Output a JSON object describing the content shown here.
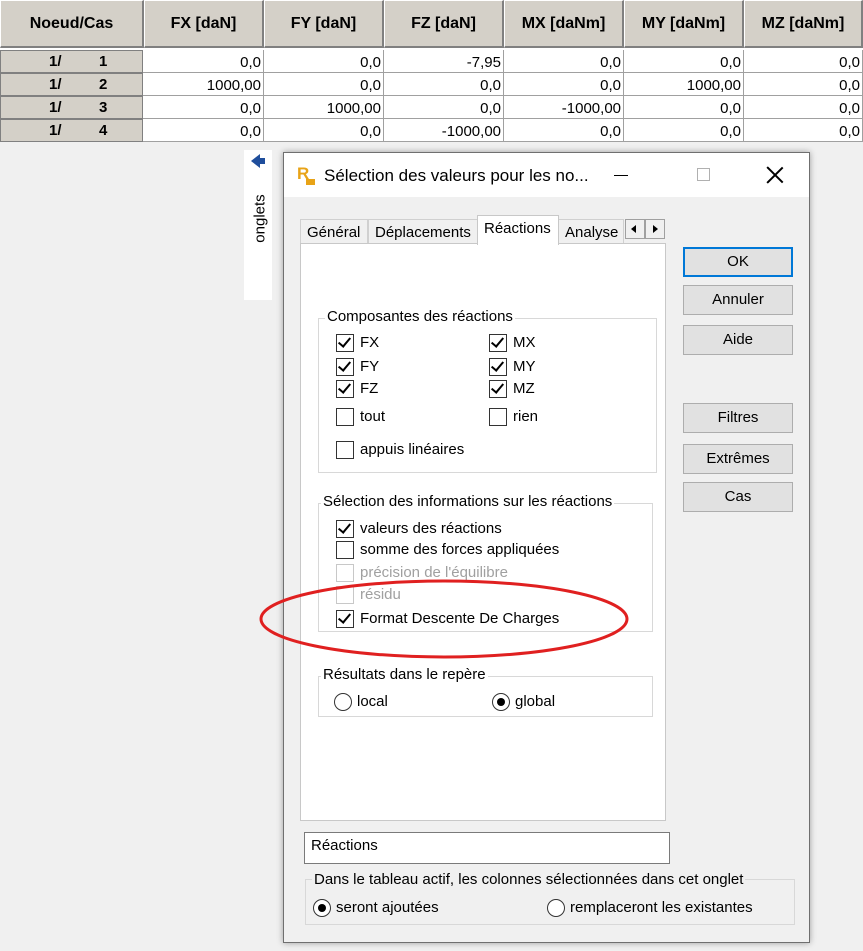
{
  "table": {
    "headers": [
      "Noeud/Cas",
      "FX [daN]",
      "FY [daN]",
      "FZ [daN]",
      "MX [daNm]",
      "MY [daNm]",
      "MZ [daNm]"
    ],
    "rows": [
      {
        "node": "1/",
        "case": "1",
        "values": [
          "0,0",
          "0,0",
          "-7,95",
          "0,0",
          "0,0",
          "0,0"
        ]
      },
      {
        "node": "1/",
        "case": "2",
        "values": [
          "1000,00",
          "0,0",
          "0,0",
          "0,0",
          "1000,00",
          "0,0"
        ]
      },
      {
        "node": "1/",
        "case": "3",
        "values": [
          "0,0",
          "1000,00",
          "0,0",
          "-1000,00",
          "0,0",
          "0,0"
        ]
      },
      {
        "node": "1/",
        "case": "4",
        "values": [
          "0,0",
          "0,0",
          "-1000,00",
          "0,0",
          "0,0",
          "0,0"
        ]
      }
    ]
  },
  "side_tab": {
    "label": "onglets"
  },
  "dialog": {
    "title": "Sélection des valeurs pour les no...",
    "tabs": [
      "Général",
      "Déplacements",
      "Réactions",
      "Analyse"
    ],
    "active_tab": "Réactions",
    "components_group": {
      "title": "Composantes des réactions",
      "items": [
        {
          "label": "FX",
          "checked": true
        },
        {
          "label": "FY",
          "checked": true
        },
        {
          "label": "FZ",
          "checked": true
        },
        {
          "label": "MX",
          "checked": true
        },
        {
          "label": "MY",
          "checked": true
        },
        {
          "label": "MZ",
          "checked": true
        },
        {
          "label": "tout",
          "checked": false
        },
        {
          "label": "rien",
          "checked": false
        },
        {
          "label": "appuis linéaires",
          "checked": false
        }
      ]
    },
    "info_group": {
      "title": "Sélection des informations sur les réactions",
      "items": [
        {
          "label": "valeurs des réactions",
          "checked": true,
          "enabled": true
        },
        {
          "label": "somme des forces appliquées",
          "checked": false,
          "enabled": true
        },
        {
          "label": "précision de l'équilibre",
          "checked": false,
          "enabled": false
        },
        {
          "label": "résidu",
          "checked": false,
          "enabled": false
        },
        {
          "label": "Format Descente De Charges",
          "checked": true,
          "enabled": true
        }
      ]
    },
    "frame_group": {
      "title": "Résultats dans le repère",
      "options": [
        {
          "label": "local",
          "selected": false
        },
        {
          "label": "global",
          "selected": true
        }
      ]
    },
    "buttons": {
      "ok": "OK",
      "cancel": "Annuler",
      "help": "Aide",
      "filters": "Filtres",
      "extremes": "Extrêmes",
      "cases": "Cas"
    },
    "name_field": "Réactions",
    "columns_group": {
      "title": "Dans le tableau actif, les colonnes sélectionnées dans cet onglet",
      "options": [
        {
          "label": "seront ajoutées",
          "selected": true
        },
        {
          "label": "remplaceront les existantes",
          "selected": false
        }
      ]
    }
  },
  "colors": {
    "accent": "#0078d7",
    "annotation": "#e02020",
    "header_bg": "#d4d0c8"
  }
}
